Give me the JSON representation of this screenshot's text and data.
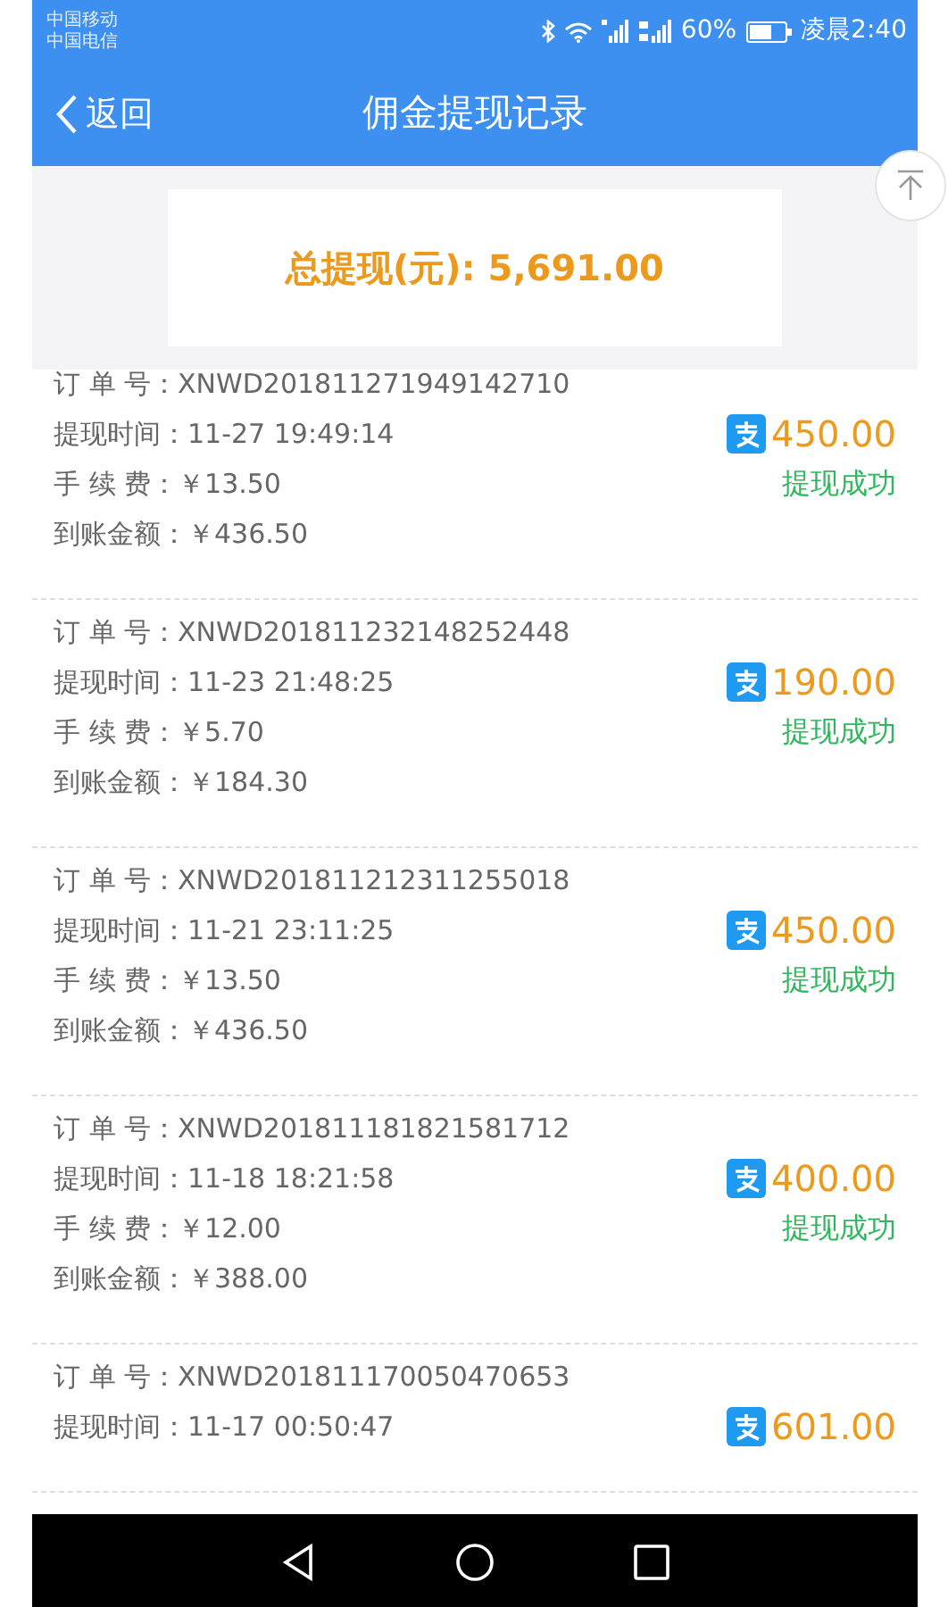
{
  "status_bar": {
    "carriers": [
      "中国移动",
      "中国电信"
    ],
    "battery": "60%",
    "time": "凌晨2:40"
  },
  "nav": {
    "back": "返回",
    "title": "佣金提现记录"
  },
  "summary": {
    "text": "总提现(元): 5,691.00"
  },
  "records": [
    {
      "lines": [
        {
          "label": "订 单 号：",
          "value": "XNWD201811271949142710"
        },
        {
          "label": "提现时间：",
          "value": "11-27 19:49:14"
        },
        {
          "label": "手 续 费：",
          "value": "￥13.50"
        },
        {
          "label": "到账金额：",
          "value": "￥436.50"
        }
      ],
      "amount": "450.00",
      "status": "提现成功"
    },
    {
      "lines": [
        {
          "label": "订 单 号：",
          "value": "XNWD201811232148252448"
        },
        {
          "label": "提现时间：",
          "value": "11-23 21:48:25"
        },
        {
          "label": "手 续 费：",
          "value": "￥5.70"
        },
        {
          "label": "到账金额：",
          "value": "￥184.30"
        }
      ],
      "amount": "190.00",
      "status": "提现成功"
    },
    {
      "lines": [
        {
          "label": "订 单 号：",
          "value": "XNWD201811212311255018"
        },
        {
          "label": "提现时间：",
          "value": "11-21 23:11:25"
        },
        {
          "label": "手 续 费：",
          "value": "￥13.50"
        },
        {
          "label": "到账金额：",
          "value": "￥436.50"
        }
      ],
      "amount": "450.00",
      "status": "提现成功"
    },
    {
      "lines": [
        {
          "label": "订 单 号：",
          "value": "XNWD201811181821581712"
        },
        {
          "label": "提现时间：",
          "value": "11-18 18:21:58"
        },
        {
          "label": "手 续 费：",
          "value": "￥12.00"
        },
        {
          "label": "到账金额：",
          "value": "￥388.00"
        }
      ],
      "amount": "400.00",
      "status": "提现成功"
    },
    {
      "lines": [
        {
          "label": "订 单 号：",
          "value": "XNWD201811170050470653"
        },
        {
          "label": "提现时间：",
          "value": "11-17 00:50:47"
        }
      ],
      "amount": "601.00"
    }
  ]
}
